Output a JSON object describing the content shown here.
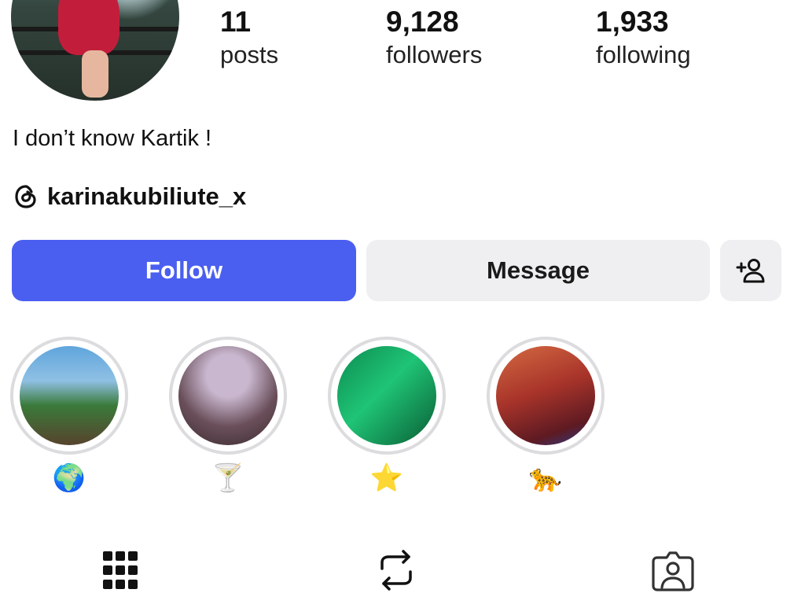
{
  "profile": {
    "stats": [
      {
        "value": "11",
        "label": "posts"
      },
      {
        "value": "9,128",
        "label": "followers"
      },
      {
        "value": "1,933",
        "label": "following"
      }
    ],
    "bio": "I don’t know Kartik !",
    "threads_handle": "karinakubiliute_x"
  },
  "actions": {
    "follow_label": "Follow",
    "message_label": "Message",
    "add_icon": "add-person-icon"
  },
  "highlights": [
    {
      "emoji": "🌍"
    },
    {
      "emoji": "🍸"
    },
    {
      "emoji": "⭐"
    },
    {
      "emoji": "🐆"
    }
  ],
  "tabs": [
    {
      "icon": "grid-icon"
    },
    {
      "icon": "reels-repost-icon"
    },
    {
      "icon": "tagged-icon"
    }
  ],
  "colors": {
    "follow_button": "#4a5ff0",
    "secondary_button": "#efeff1"
  }
}
